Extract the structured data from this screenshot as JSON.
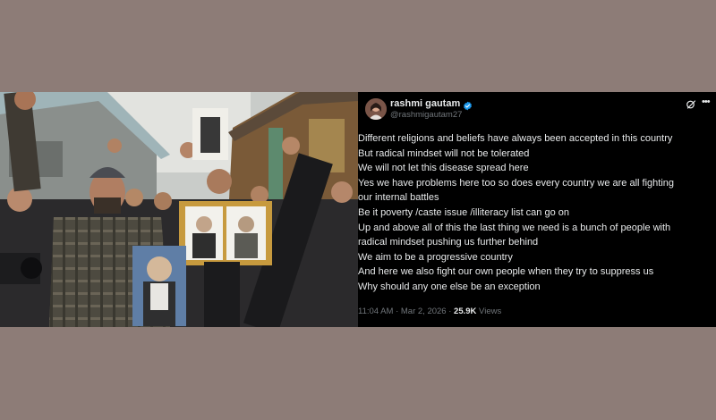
{
  "tweet": {
    "display_name": "rashmi gautam",
    "handle": "@rashmigautam27",
    "lines": [
      "Different religions and beliefs have always been accepted in this country",
      "But radical mindset will not be tolerated",
      "We will not let this disease spread here",
      "Yes we have problems here too so does every country we are all fighting",
      "our internal battles",
      "Be it poverty /caste issue /illiteracy list can go on",
      "Up and above all of this the last thing we need is a bunch of people with",
      "radical mindset pushing us further behind",
      "We aim to be a progressive country",
      "And here we also fight our own people when they try to suppress us",
      "Why should any one else be an exception"
    ],
    "time": "11:04 AM",
    "separator": " · ",
    "date": "Mar 2, 2026",
    "views": "25.9K",
    "views_label": "Views",
    "verified_color": "#1d9bf0",
    "icons": [
      "verified-badge-icon",
      "grok-icon",
      "more-options-icon"
    ]
  },
  "colors": {
    "page_background": "#8d7c77",
    "tweet_background": "#000000",
    "text": "#e7e9ea",
    "secondary_text": "#71767b"
  }
}
